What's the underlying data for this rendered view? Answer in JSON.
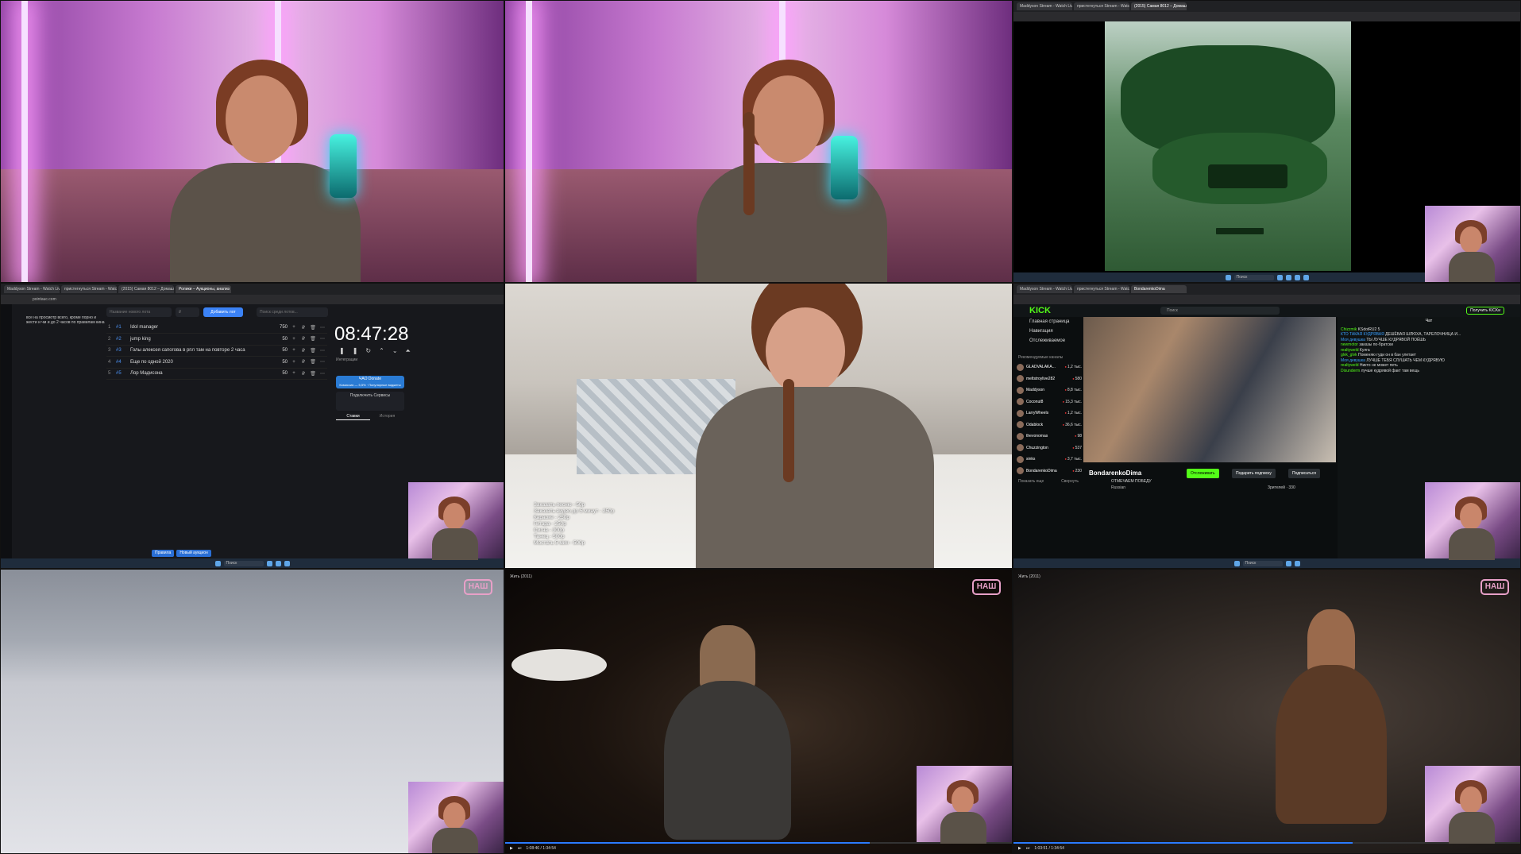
{
  "browser1": {
    "tabs": [
      "Maddyson Stream - Watch Liv",
      "пристегнуться Stream - Watch",
      "(2015) Самая 8012 – Домаш",
      "Ролики – Аукционы, анализ"
    ],
    "url": "pointauc.com"
  },
  "auction": {
    "note": "все на просмотр всего, кроме порно и жести и чм и до 2 часов по правилам кина",
    "new_lot_placeholder": "Название нового лота",
    "price_placeholder": "₽",
    "add_button": "Добавить лот",
    "search_placeholder": "Поиск среди лотов...",
    "lots": [
      {
        "n": "1",
        "tag": "#1",
        "name": "Idol manager",
        "price": "750"
      },
      {
        "n": "2",
        "tag": "#2",
        "name": "jump king",
        "price": "50"
      },
      {
        "n": "3",
        "tag": "#3",
        "name": "Голы алексея сапогова в рпл там на повторе 2 часа",
        "price": "50"
      },
      {
        "n": "4",
        "tag": "#4",
        "name": "Еще по одной 2020",
        "price": "50"
      },
      {
        "n": "5",
        "tag": "#5",
        "name": "Лор Мадисона",
        "price": "50"
      }
    ],
    "timer": "08:47:28",
    "integrations_label": "Интеграции",
    "donate_label": "ЧАО Donate",
    "donate_sub": "Комиссия — 5,5% · Популярные виджеты",
    "services_label": "Подключить Сервисы",
    "subtab_active": "Ставки",
    "subtab_other": "История",
    "bottom_buttons": [
      "Правила",
      "Новый аукцион"
    ]
  },
  "kitchen_rules": [
    "Заказать песню - 50р",
    "Заказать видео до 5 минут - 250р",
    "Караоке - 250р",
    "Гитара - 250р",
    "Сигна - 300р",
    "Танец - 500р",
    "Мостать 5 мин - 500р"
  ],
  "kick": {
    "logo": "KICK",
    "search": "Поиск",
    "get_kicks": "Получить KICKи",
    "nav": [
      "Главная страница",
      "Навигация",
      "Отслеживаемое"
    ],
    "recommended_label": "Рекомендуемые каналы",
    "channels": [
      {
        "name": "GLADVALAKA...",
        "count": "1,2 тыс."
      },
      {
        "name": "meltstroylive282",
        "count": "580"
      },
      {
        "name": "Maddyson",
        "count": "8,8 тыс."
      },
      {
        "name": "Coconut8",
        "count": "15,3 тыс."
      },
      {
        "name": "LarryWheels",
        "count": "1,2 тыс."
      },
      {
        "name": "Odablock",
        "count": "36,6 тыс."
      },
      {
        "name": "thevonomas",
        "count": "98"
      },
      {
        "name": "Chuzzington",
        "count": "537"
      },
      {
        "name": "sinks",
        "count": "3,7 тыс."
      },
      {
        "name": "BondarenkoDima",
        "count": "230"
      }
    ],
    "show_more": "Показать еще",
    "collapse": "Свернуть",
    "streamer": "BondarenkoDima",
    "stream_title": "ОТМЕЧАЕМ ПОБЕДУ",
    "language": "Russian",
    "follow_button": "Отслеживать",
    "gift_button": "Подарить подписку",
    "subscribe_button": "Подписаться",
    "viewers": "Зрителей · 330",
    "chat_header": "Чат",
    "chat": [
      {
        "user": "Chizzmik",
        "text": "KSdotRU2 5"
      },
      {
        "user": "КТО ТАКАЯ КУДРЯВАЯ",
        "text": "ДЕШЁВАЯ ШЛЮХА, ТАРЕЛОЧНИЦА И..."
      },
      {
        "user": "Моя девушка",
        "text": "ТЫ ЛУЧШЕ КУДРЯВОЙ ПОЁШЬ"
      },
      {
        "user": "newmotor",
        "text": "заказы по-братски"
      },
      {
        "user": "realtyweld",
        "text": "Кулга"
      },
      {
        "user": "glvk_glvk",
        "text": "Поменяю гуди он в бан улетает"
      },
      {
        "user": "Моя девушка",
        "text": "ЛУЧШЕ ТЕБЯ СЛУШАТЬ ЧЕМ КУДРЯВУЮ"
      },
      {
        "user": "realtyweld",
        "text": "Никто не может петь"
      },
      {
        "user": "Disunderm",
        "text": "лучше кудрявой факт там вещь"
      }
    ]
  },
  "movies": {
    "logo": "НАШ",
    "title": "Жить (2011)",
    "time_mid": "1:08:46 / 1:34:54",
    "time_right": "1:03:51 / 1:34:54",
    "progress_mid": 0.72,
    "progress_right": 0.67
  },
  "taskbar_search": "Поиск"
}
